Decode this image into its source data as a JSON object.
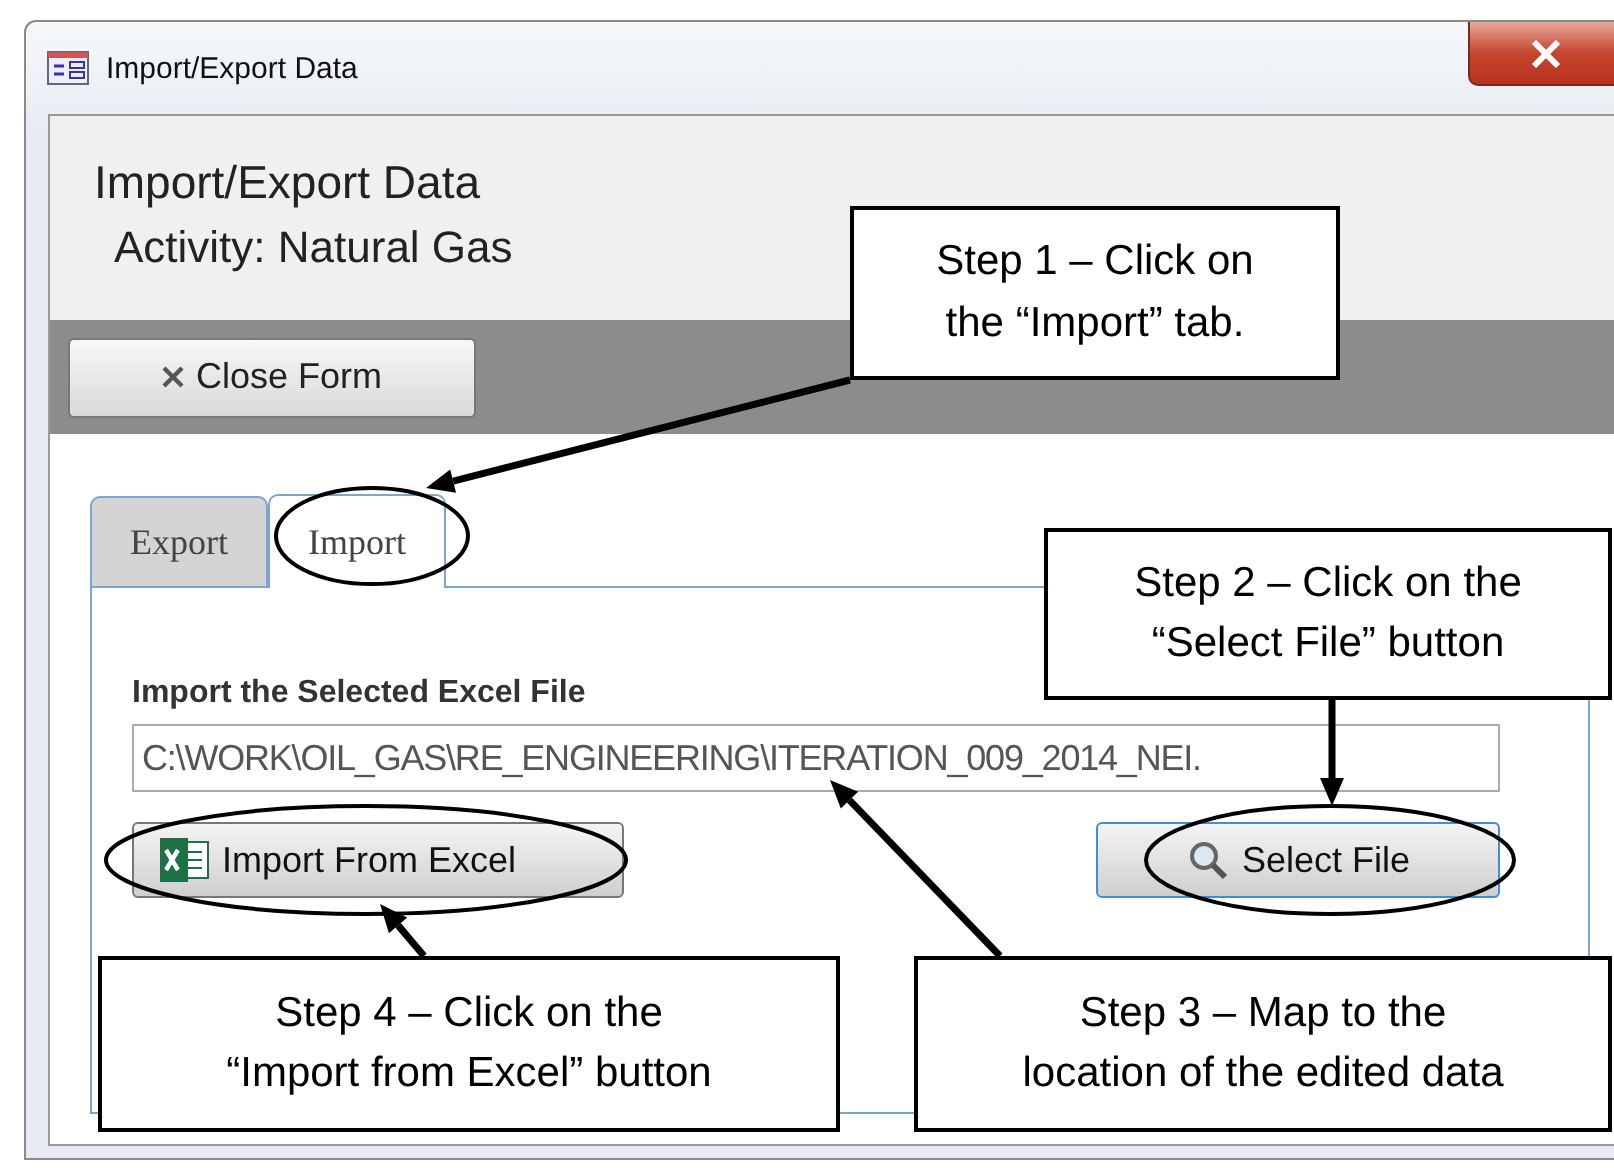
{
  "window": {
    "title": "Import/Export Data"
  },
  "header": {
    "title": "Import/Export Data",
    "subtitle": "Activity: Natural Gas"
  },
  "close_form_button": {
    "label": "Close Form"
  },
  "tabs": [
    {
      "label": "Export",
      "selected": false
    },
    {
      "label": "Import",
      "selected": true
    }
  ],
  "import_panel": {
    "label": "Import the Selected Excel File",
    "path_value": "C:\\WORK\\OIL_GAS\\RE_ENGINEERING\\ITERATION_009_2014_NEI.",
    "buttons": [
      {
        "kind": "excel",
        "label": "Import From Excel"
      },
      {
        "kind": "search",
        "label": "Select File"
      }
    ]
  },
  "callouts": [
    {
      "text": "Step 1 – Click on\nthe “Import” tab."
    },
    {
      "text": "Step 2 – Click on the\n“Select File” button"
    },
    {
      "text": "Step 4 – Click on the\n“Import from Excel” button"
    },
    {
      "text": "Step 3 – Map to the\nlocation of the edited data"
    }
  ]
}
